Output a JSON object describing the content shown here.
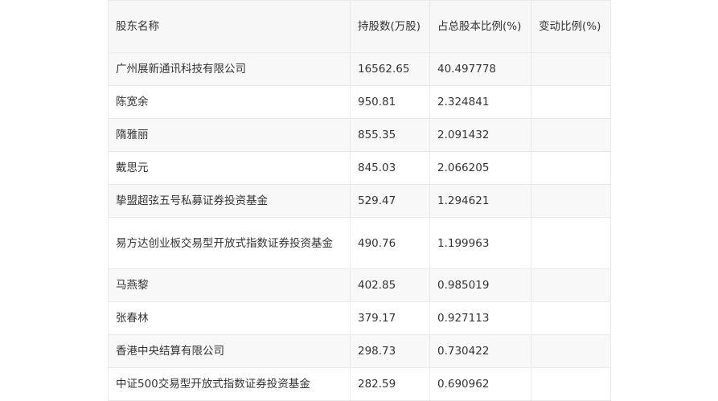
{
  "table": {
    "headers": [
      "股东名称",
      "持股数(万股)",
      "占总股本比例(%)",
      "变动比例(%)"
    ],
    "rows": [
      [
        "广州展新通讯科技有限公司",
        "16562.65",
        "40.497778",
        ""
      ],
      [
        "陈宽余",
        "950.81",
        "2.324841",
        ""
      ],
      [
        "隋雅丽",
        "855.35",
        "2.091432",
        ""
      ],
      [
        "戴思元",
        "845.03",
        "2.066205",
        ""
      ],
      [
        "挚盟超弦五号私募证券投资基金",
        "529.47",
        "1.294621",
        ""
      ],
      [
        "易方达创业板交易型开放式指数证券投资基金",
        "490.76",
        "1.199963",
        ""
      ],
      [
        "马燕黎",
        "402.85",
        "0.985019",
        ""
      ],
      [
        "张春林",
        "379.17",
        "0.927113",
        ""
      ],
      [
        "香港中央结算有限公司",
        "298.73",
        "0.730422",
        ""
      ],
      [
        "中证500交易型开放式指数证券投资基金",
        "282.59",
        "0.690962",
        ""
      ]
    ]
  }
}
